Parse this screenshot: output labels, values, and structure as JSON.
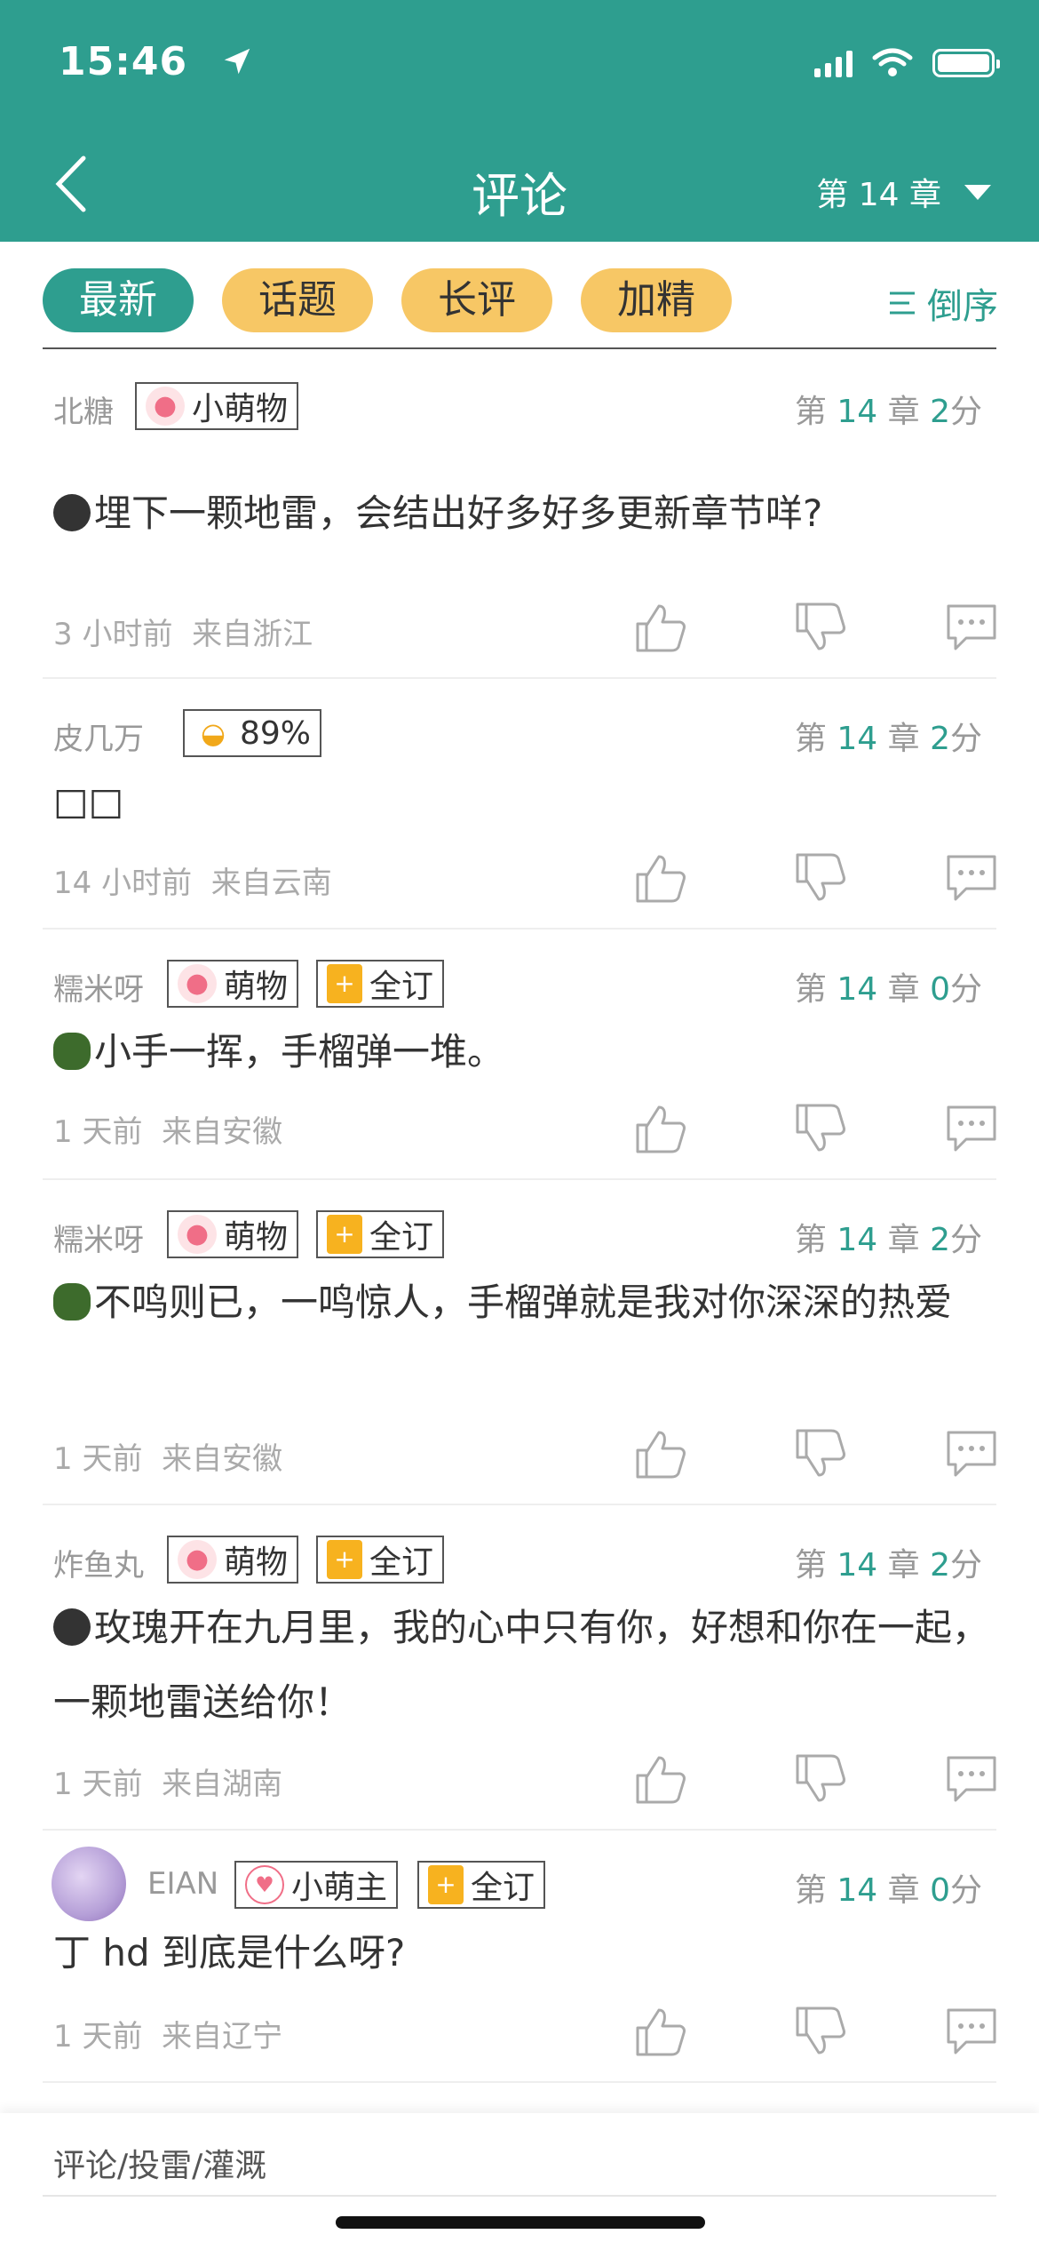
{
  "status": {
    "time": "15:46"
  },
  "header": {
    "title": "评论",
    "chapter": "第 14 章"
  },
  "tabs": [
    {
      "label": "最新",
      "active": true
    },
    {
      "label": "话题",
      "active": false
    },
    {
      "label": "长评",
      "active": false
    },
    {
      "label": "加精",
      "active": false
    }
  ],
  "sort": {
    "label": "倒序"
  },
  "comments": [
    {
      "user": "北糖",
      "badges": [
        {
          "icon": "paw-icon",
          "label": "小萌物"
        }
      ],
      "chapter_prefix": "第 ",
      "chapter": "14",
      "chapter_suffix": " 章 ",
      "score": "2",
      "score_suffix": "分",
      "text": "埋下一颗地雷，会结出好多好多更新章节咩?",
      "gift": "bomb",
      "time": "3 小时前",
      "location": "来自浙江"
    },
    {
      "user": "皮几万",
      "badges": [
        {
          "icon": "ingot-icon",
          "label": "89%"
        }
      ],
      "chapter_prefix": "第 ",
      "chapter": "14",
      "chapter_suffix": " 章 ",
      "score": "2",
      "score_suffix": "分",
      "text": "□□",
      "gift": "",
      "time": "14 小时前",
      "location": "来自云南"
    },
    {
      "user": "糯米呀",
      "badges": [
        {
          "icon": "paw-icon",
          "label": "萌物"
        },
        {
          "icon": "bookmark-icon",
          "label": "全订"
        }
      ],
      "chapter_prefix": "第 ",
      "chapter": "14",
      "chapter_suffix": " 章 ",
      "score": "0",
      "score_suffix": "分",
      "text": "小手一挥，手榴弹一堆。",
      "gift": "grenade",
      "time": "1 天前",
      "location": "来自安徽"
    },
    {
      "user": "糯米呀",
      "badges": [
        {
          "icon": "paw-icon",
          "label": "萌物"
        },
        {
          "icon": "bookmark-icon",
          "label": "全订"
        }
      ],
      "chapter_prefix": "第 ",
      "chapter": "14",
      "chapter_suffix": " 章 ",
      "score": "2",
      "score_suffix": "分",
      "text": "不鸣则已，一鸣惊人，手榴弹就是我对你深深的热爱",
      "gift": "grenade",
      "time": "1 天前",
      "location": "来自安徽"
    },
    {
      "user": "炸鱼丸",
      "badges": [
        {
          "icon": "paw-icon",
          "label": "萌物"
        },
        {
          "icon": "bookmark-icon",
          "label": "全订"
        }
      ],
      "chapter_prefix": "第 ",
      "chapter": "14",
      "chapter_suffix": " 章 ",
      "score": "2",
      "score_suffix": "分",
      "text": "玫瑰开在九月里，我的心中只有你，好想和你在一起，一颗地雷送给你！",
      "gift": "bomb",
      "time": "1 天前",
      "location": "来自湖南"
    },
    {
      "user": "EIAN",
      "badges": [
        {
          "icon": "crown-icon",
          "label": "小萌主"
        },
        {
          "icon": "bookmark-icon",
          "label": "全订"
        }
      ],
      "chapter_prefix": "第 ",
      "chapter": "14",
      "chapter_suffix": " 章 ",
      "score": "0",
      "score_suffix": "分",
      "text": "丁 hd 到底是什么呀?",
      "gift": "",
      "time": "1 天前",
      "location": "来自辽宁"
    }
  ],
  "bottom": {
    "input_placeholder": "评论/投雷/灌溉"
  }
}
